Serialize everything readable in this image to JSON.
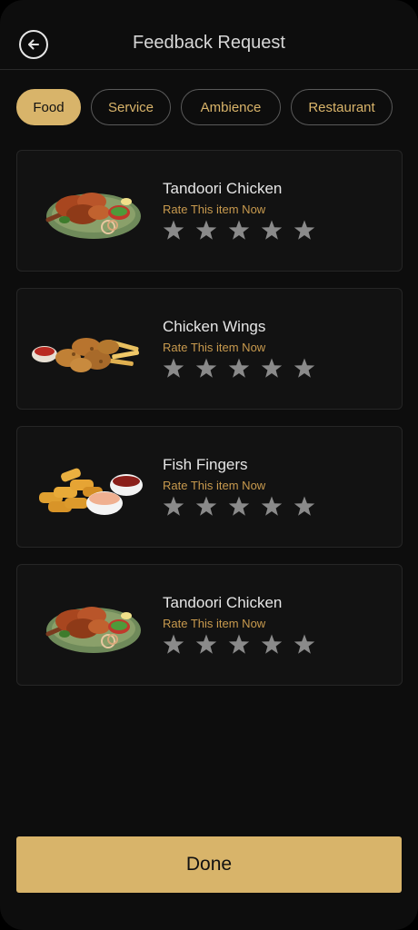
{
  "header": {
    "title": "Feedback Request",
    "back_icon": "arrow-left-icon"
  },
  "tabs": [
    {
      "label": "Food",
      "active": true
    },
    {
      "label": "Service",
      "active": false
    },
    {
      "label": "Ambience",
      "active": false
    },
    {
      "label": "Restaurant",
      "active": false
    }
  ],
  "items": [
    {
      "name": "Tandoori Chicken",
      "rate_text": "Rate This item Now",
      "image": "tandoori-chicken-image",
      "rating": 0
    },
    {
      "name": "Chicken Wings",
      "rate_text": "Rate This item Now",
      "image": "chicken-wings-image",
      "rating": 0
    },
    {
      "name": "Fish Fingers",
      "rate_text": "Rate This item Now",
      "image": "fish-fingers-image",
      "rating": 0
    },
    {
      "name": "Tandoori Chicken",
      "rate_text": "Rate This item Now",
      "image": "tandoori-chicken-image",
      "rating": 0
    }
  ],
  "footer": {
    "done_label": "Done"
  },
  "colors": {
    "accent": "#d8b46a",
    "rate_text": "#c89a4e",
    "star_empty": "#8a8a8a",
    "background": "#0d0d0d",
    "card": "#121212"
  }
}
